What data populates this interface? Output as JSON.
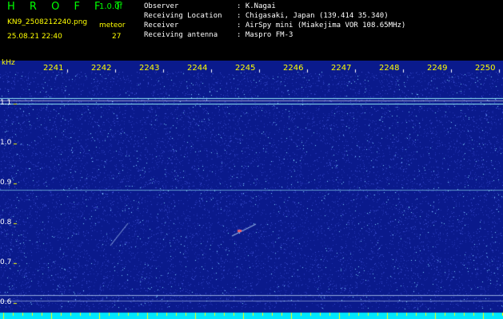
{
  "header": {
    "app_title": "H R O F F T",
    "version": "1.0.0f",
    "filename": "KN9_2508212240.png",
    "meteor_label": "meteor",
    "datetime": "25.08.21 22:40",
    "meteor_count": "27"
  },
  "info": [
    {
      "key": "Observer",
      "value": ": K.Nagai"
    },
    {
      "key": "Receiving Location",
      "value": ": Chigasaki, Japan (139.414 35.340)"
    },
    {
      "key": "Receiver",
      "value": ": AirSpy mini (Miakejima VOR 108.65MHz)"
    },
    {
      "key": "Receiving antenna",
      "value": ": Maspro FM-3"
    }
  ],
  "plot": {
    "y_unit": "kHz",
    "x_ticks": [
      "2241",
      "2242",
      "2243",
      "2244",
      "2245",
      "2246",
      "2247",
      "2248",
      "2249",
      "2250"
    ],
    "y_ticks": [
      "1.1",
      "1.0",
      "0.9",
      "0.8",
      "0.7",
      "0.6"
    ],
    "colors": {
      "background": "#0a1a8c",
      "noise_dim": "#3a4fd0",
      "noise_bright": "#7fd0ff",
      "carrier": "#a0ffff",
      "text_yellow": "#ffff00",
      "text_green": "#00ff00"
    }
  }
}
